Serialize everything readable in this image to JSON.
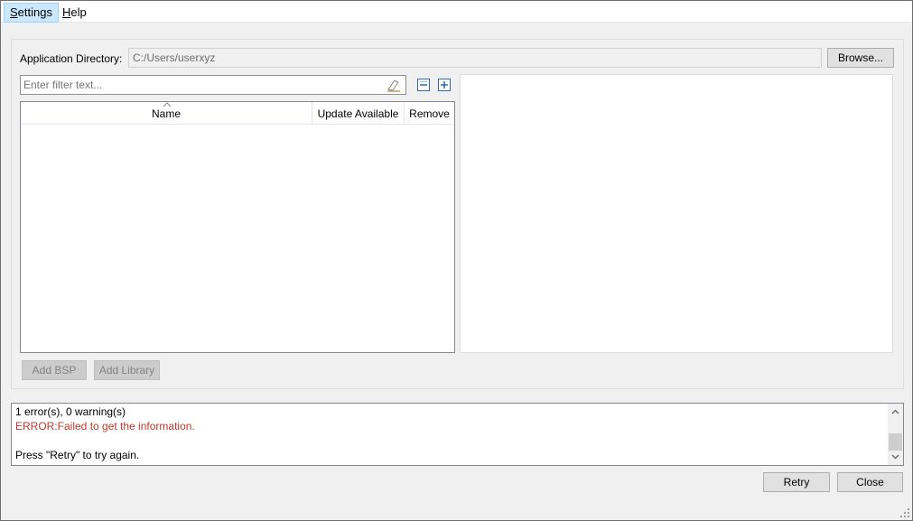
{
  "menu": {
    "settings": {
      "first": "S",
      "rest": "ettings"
    },
    "help": {
      "first": "H",
      "rest": "elp"
    }
  },
  "app_directory": {
    "label": "Application Directory:",
    "value": "C:/Users/userxyz",
    "browse_label": "Browse..."
  },
  "filter": {
    "placeholder": "Enter filter text..."
  },
  "table": {
    "columns": [
      "Name",
      "Update Available",
      "Remove"
    ],
    "rows": []
  },
  "actions": {
    "add_bsp": "Add BSP",
    "add_library": "Add Library"
  },
  "console": {
    "summary": "1 error(s), 0 warning(s)",
    "error": "ERROR:Failed to get the information.",
    "hint": "Press \"Retry\" to try again.",
    "error_color": "#c0392b"
  },
  "footer": {
    "retry": "Retry",
    "close": "Close"
  },
  "icons": {
    "eraser": "eraser-icon",
    "collapse": "collapse-all-icon",
    "expand": "expand-all-icon",
    "sort": "sort-ascending-icon",
    "scroll_up": "chevron-up-icon",
    "scroll_down": "chevron-down-icon",
    "grip": "resize-grip-icon"
  }
}
